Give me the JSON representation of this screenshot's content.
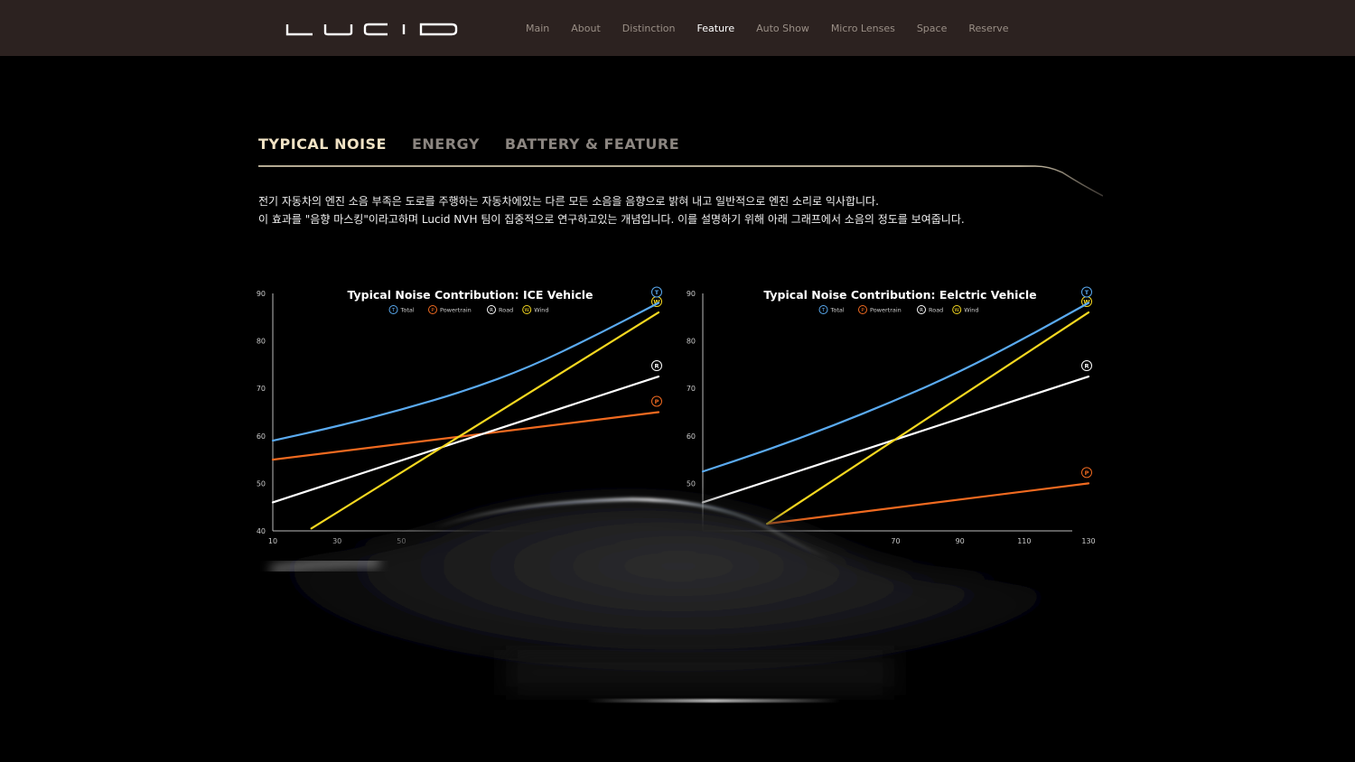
{
  "header": {
    "logo_text": "LUCID",
    "nav": [
      {
        "label": "Main",
        "active": false
      },
      {
        "label": "About",
        "active": false
      },
      {
        "label": "Distinction",
        "active": false
      },
      {
        "label": "Feature",
        "active": true
      },
      {
        "label": "Auto Show",
        "active": false
      },
      {
        "label": "Micro Lenses",
        "active": false
      },
      {
        "label": "Space",
        "active": false
      },
      {
        "label": "Reserve",
        "active": false
      }
    ]
  },
  "tabs": [
    {
      "label": "TYPICAL NOISE",
      "active": true
    },
    {
      "label": "ENERGY",
      "active": false
    },
    {
      "label": "BATTERY & FEATURE",
      "active": false
    }
  ],
  "description": {
    "line1": "전기 자동차의 엔진 소음 부족은 도로를 주행하는 자동차에있는 다른 모든 소음을 음향으로 밝혀 내고 일반적으로 엔진 소리로 익사합니다.",
    "line2": "이 효과를 \"음향 마스킹\"이라고하며 Lucid NVH 팀이 집중적으로 연구하고있는 개념입니다. 이를 설명하기 위해 아래 그래프에서 소음의 정도를 보여줍니다."
  },
  "colors": {
    "Total": "#5aaaf0",
    "Powertrain": "#f06a20",
    "Road": "#ffffff",
    "Wind": "#f5d820",
    "accent": "#f0e2c4",
    "header_bg": "#2c2220"
  },
  "chart_data": [
    {
      "type": "line",
      "title": "Typical Noise Contribution: ICE Vehicle",
      "legend_placement": "top-center",
      "grid": false,
      "x_ticks": [
        10,
        30,
        50
      ],
      "y_ticks": [
        40,
        50,
        60,
        70,
        80,
        90
      ],
      "xlim": [
        10,
        130
      ],
      "ylim": [
        40,
        90
      ],
      "series": [
        {
          "name": "Total",
          "letter": "T",
          "x": [
            10,
            30,
            50,
            70,
            90,
            110,
            130
          ],
          "values": [
            59,
            62,
            65.5,
            69.5,
            74.5,
            81,
            88
          ]
        },
        {
          "name": "Powertrain",
          "letter": "P",
          "x": [
            10,
            130
          ],
          "values": [
            55,
            65
          ]
        },
        {
          "name": "Road",
          "letter": "R",
          "x": [
            10,
            130
          ],
          "values": [
            46,
            72.5
          ]
        },
        {
          "name": "Wind",
          "letter": "W",
          "x": [
            22,
            130
          ],
          "values": [
            40.5,
            86
          ]
        }
      ]
    },
    {
      "type": "line",
      "title": "Typical Noise Contribution: Eelctric Vehicle",
      "legend_placement": "top-center",
      "grid": false,
      "x_ticks": [
        70,
        90,
        110,
        130
      ],
      "y_ticks": [
        50,
        60,
        70,
        80,
        90
      ],
      "xlim": [
        10,
        130
      ],
      "ylim": [
        40,
        90
      ],
      "series": [
        {
          "name": "Total",
          "letter": "T",
          "x": [
            10,
            30,
            50,
            70,
            90,
            110,
            130
          ],
          "values": [
            52.5,
            57,
            62,
            67.5,
            73.5,
            80.5,
            88
          ]
        },
        {
          "name": "Powertrain",
          "letter": "P",
          "x": [
            30,
            130
          ],
          "values": [
            41.5,
            50
          ]
        },
        {
          "name": "Road",
          "letter": "R",
          "x": [
            10,
            130
          ],
          "values": [
            46,
            72.5
          ]
        },
        {
          "name": "Wind",
          "letter": "W",
          "x": [
            30,
            130
          ],
          "values": [
            41.5,
            86
          ]
        }
      ]
    }
  ]
}
